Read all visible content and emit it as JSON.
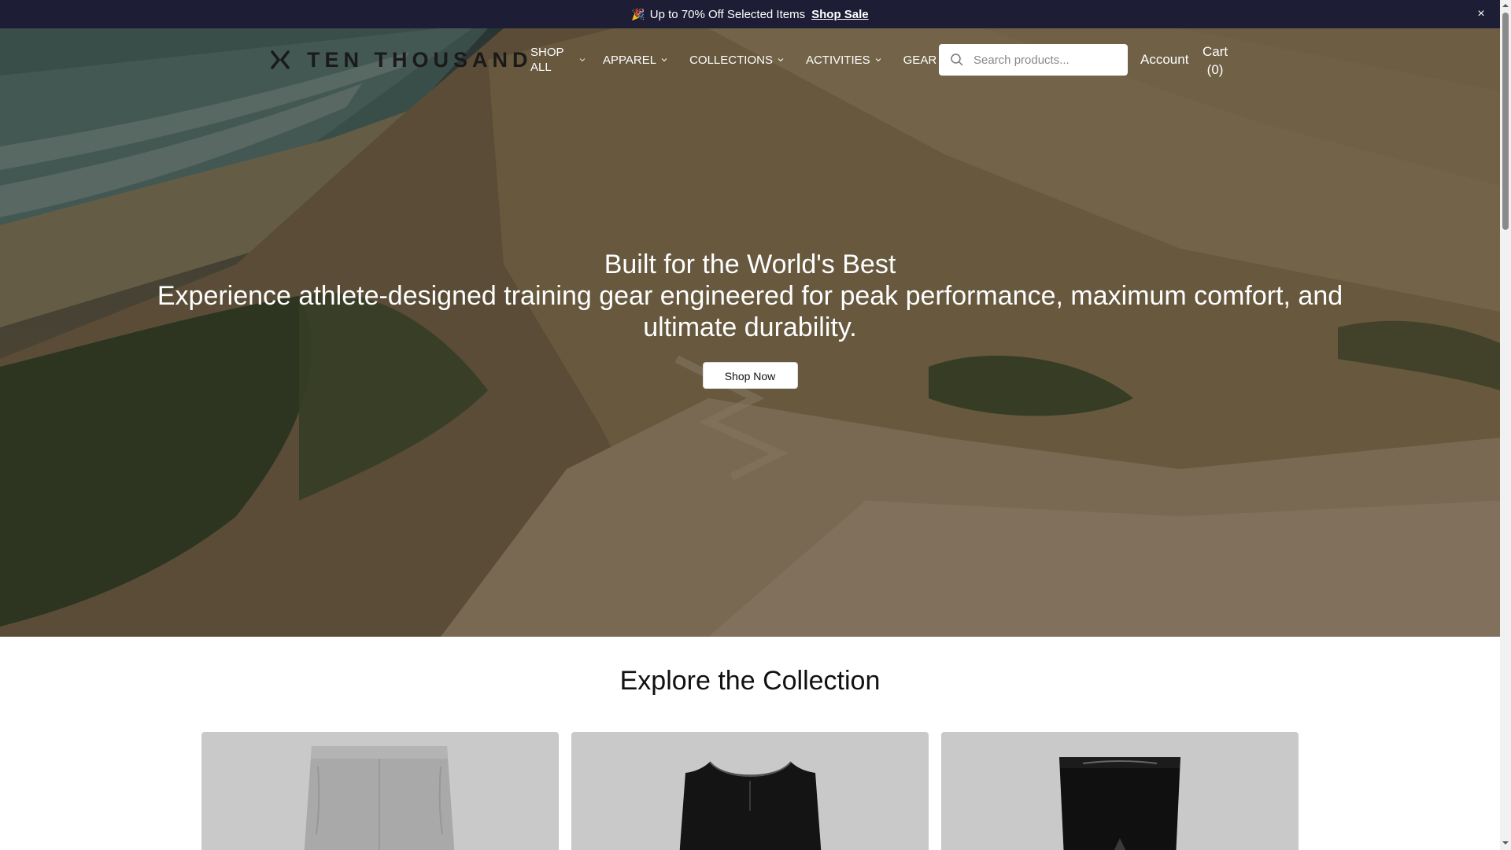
{
  "announcement": {
    "emoji": "🎉",
    "text": "Up to 70% Off Selected Items",
    "link": "Shop Sale",
    "close": "×"
  },
  "brand": {
    "name": "TEN THOUSAND"
  },
  "nav": {
    "items": [
      {
        "label": "SHOP ALL"
      },
      {
        "label": "APPAREL"
      },
      {
        "label": "COLLECTIONS"
      },
      {
        "label": "ACTIVITIES"
      },
      {
        "label": "GEAR"
      }
    ]
  },
  "search": {
    "placeholder": "Search products..."
  },
  "account": {
    "label": "Account"
  },
  "cart": {
    "label": "Cart",
    "count": "(0)"
  },
  "hero": {
    "title": "Built for the World's Best",
    "subtitle": "Experience athlete-designed training gear engineered for peak performance, maximum comfort, and ultimate durability.",
    "cta": "Shop Now"
  },
  "collection": {
    "title": "Explore the Collection",
    "cards": [
      {
        "name": "grey-shorts"
      },
      {
        "name": "black-tank"
      },
      {
        "name": "black-briefs"
      }
    ]
  },
  "colors": {
    "announcement_bg": "#1d1d35",
    "card_bg": "#c9c9c9"
  }
}
